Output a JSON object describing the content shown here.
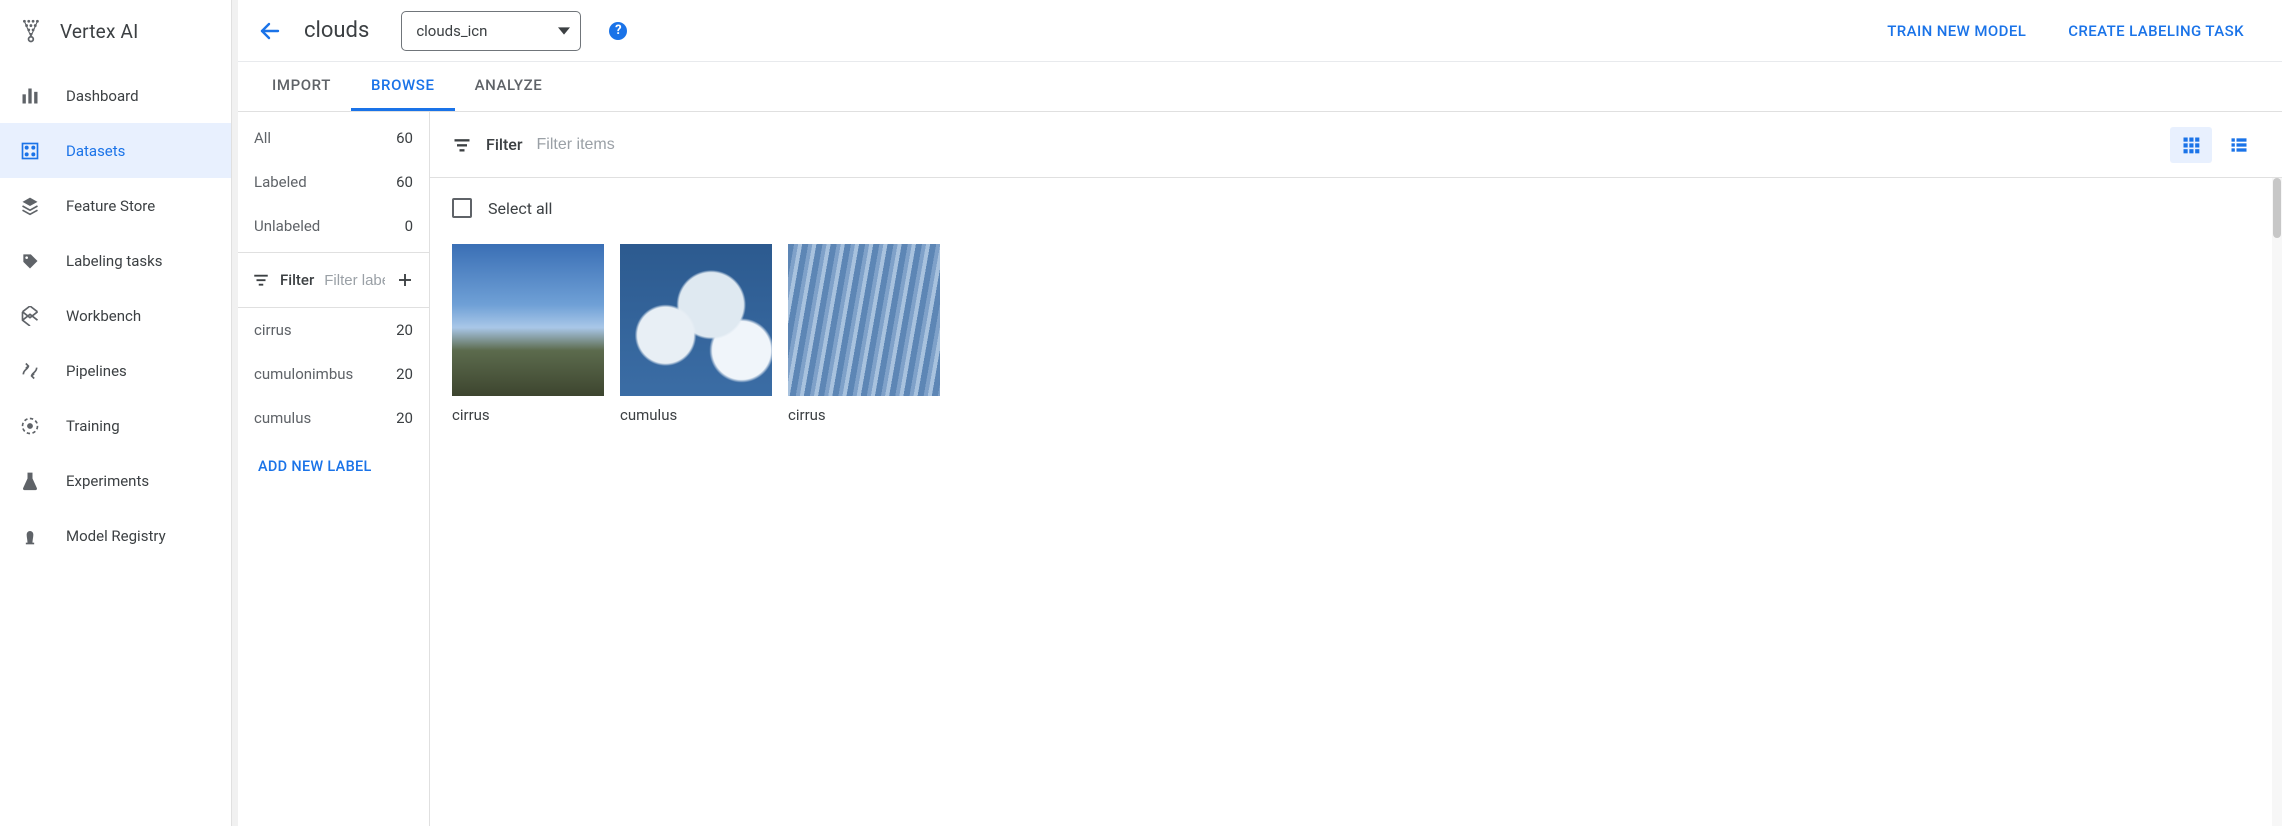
{
  "brand": {
    "name": "Vertex AI"
  },
  "nav": {
    "items": [
      {
        "label": "Dashboard"
      },
      {
        "label": "Datasets"
      },
      {
        "label": "Feature Store"
      },
      {
        "label": "Labeling tasks"
      },
      {
        "label": "Workbench"
      },
      {
        "label": "Pipelines"
      },
      {
        "label": "Training"
      },
      {
        "label": "Experiments"
      },
      {
        "label": "Model Registry"
      }
    ],
    "active_index": 1
  },
  "header": {
    "title": "clouds",
    "dataset_select": "clouds_icn",
    "actions": {
      "train": "TRAIN NEW MODEL",
      "labeling": "CREATE LABELING TASK"
    }
  },
  "tabs": {
    "items": [
      {
        "label": "IMPORT"
      },
      {
        "label": "BROWSE"
      },
      {
        "label": "ANALYZE"
      }
    ],
    "active_index": 1
  },
  "panel": {
    "stats": [
      {
        "label": "All",
        "count": "60"
      },
      {
        "label": "Labeled",
        "count": "60"
      },
      {
        "label": "Unlabeled",
        "count": "0"
      }
    ],
    "filter_word": "Filter",
    "filter_placeholder": "Filter labels",
    "labels": [
      {
        "label": "cirrus",
        "count": "20"
      },
      {
        "label": "cumulonimbus",
        "count": "20"
      },
      {
        "label": "cumulus",
        "count": "20"
      }
    ],
    "add_label": "ADD NEW LABEL"
  },
  "content": {
    "filter_word": "Filter",
    "filter_placeholder": "Filter items",
    "select_all": "Select all",
    "view": "grid",
    "images": [
      {
        "label": "cirrus",
        "variant": "sky1"
      },
      {
        "label": "cumulus",
        "variant": "sky2"
      },
      {
        "label": "cirrus",
        "variant": "sky3"
      }
    ]
  }
}
